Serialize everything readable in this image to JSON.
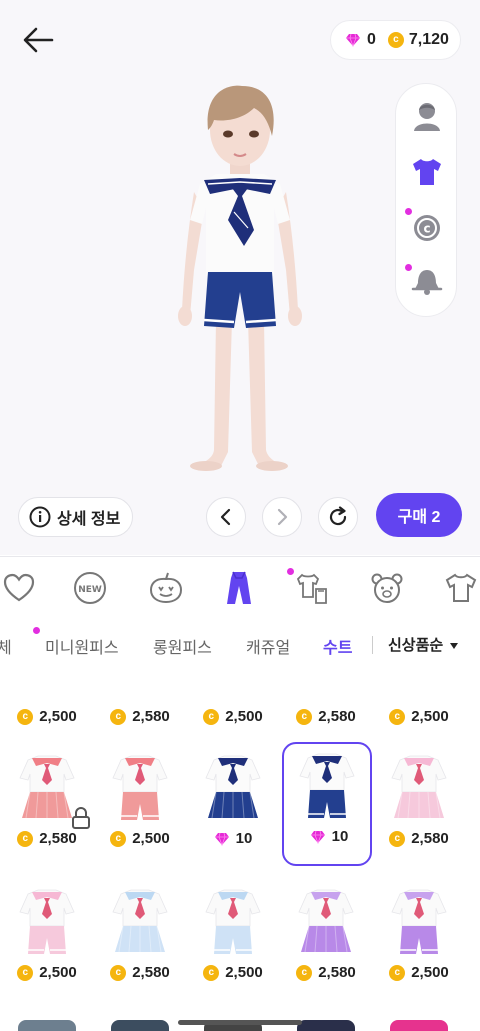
{
  "header": {
    "gems": "0",
    "coins": "7,120"
  },
  "icons": {
    "back": "back-arrow-icon",
    "gem": "gem-icon",
    "coin": "coin-icon"
  },
  "sidebar": [
    {
      "name": "face-icon",
      "active": false,
      "dot": false
    },
    {
      "name": "shirt-icon",
      "active": true,
      "dot": false
    },
    {
      "name": "brand-icon",
      "active": false,
      "dot": true
    },
    {
      "name": "bell-icon",
      "active": false,
      "dot": true
    }
  ],
  "controls": {
    "detail_label": "상세 정보",
    "buy_label": "구매 2"
  },
  "categories": [
    {
      "name": "heart-icon",
      "active": false
    },
    {
      "name": "new-icon",
      "label": "NEW",
      "active": false
    },
    {
      "name": "pumpkin-icon",
      "active": false
    },
    {
      "name": "suit-icon",
      "active": true
    },
    {
      "name": "hanger-shirt-icon",
      "active": false,
      "dot": true
    },
    {
      "name": "bear-icon",
      "active": false
    },
    {
      "name": "tshirt-icon",
      "active": false
    }
  ],
  "subtabs": [
    {
      "label": "체",
      "active": false
    },
    {
      "label": "미니원피스",
      "active": false,
      "dot": true
    },
    {
      "label": "롱원피스",
      "active": false
    },
    {
      "label": "캐쥬얼",
      "active": false
    },
    {
      "label": "수트",
      "active": true
    }
  ],
  "sort_label": "신상품순",
  "colors": {
    "accent": "#6244f0",
    "coin": "#f5b50f",
    "gem": "#e52ad6",
    "dot": "#e22ee0"
  },
  "rows": [
    [
      {
        "price": "2,500",
        "currency": "coin",
        "style": "shorts-mint"
      },
      {
        "price": "2,580",
        "currency": "coin",
        "style": "skirt-pink"
      },
      {
        "price": "2,500",
        "currency": "coin",
        "style": "shorts-pink"
      },
      {
        "price": "2,580",
        "currency": "coin",
        "style": "skirt-blue"
      },
      {
        "price": "2,500",
        "currency": "coin",
        "style": "shorts-blue"
      }
    ],
    [
      {
        "price": "2,580",
        "currency": "coin",
        "style": "sailor-red-skirt",
        "locked": true
      },
      {
        "price": "2,500",
        "currency": "coin",
        "style": "sailor-red-shorts"
      },
      {
        "price": "10",
        "currency": "gem",
        "style": "sailor-navy-skirt"
      },
      {
        "price": "10",
        "currency": "gem",
        "style": "sailor-navy-shorts",
        "selected": true
      },
      {
        "price": "2,580",
        "currency": "coin",
        "style": "sailor-pink-skirt"
      }
    ],
    [
      {
        "price": "2,500",
        "currency": "coin",
        "style": "sailor-pink-shorts"
      },
      {
        "price": "2,580",
        "currency": "coin",
        "style": "sailor-blue-skirt"
      },
      {
        "price": "2,500",
        "currency": "coin",
        "style": "sailor-blue-shorts"
      },
      {
        "price": "2,580",
        "currency": "coin",
        "style": "sailor-purple-skirt"
      },
      {
        "price": "2,500",
        "currency": "coin",
        "style": "sailor-purple-shorts"
      }
    ]
  ]
}
